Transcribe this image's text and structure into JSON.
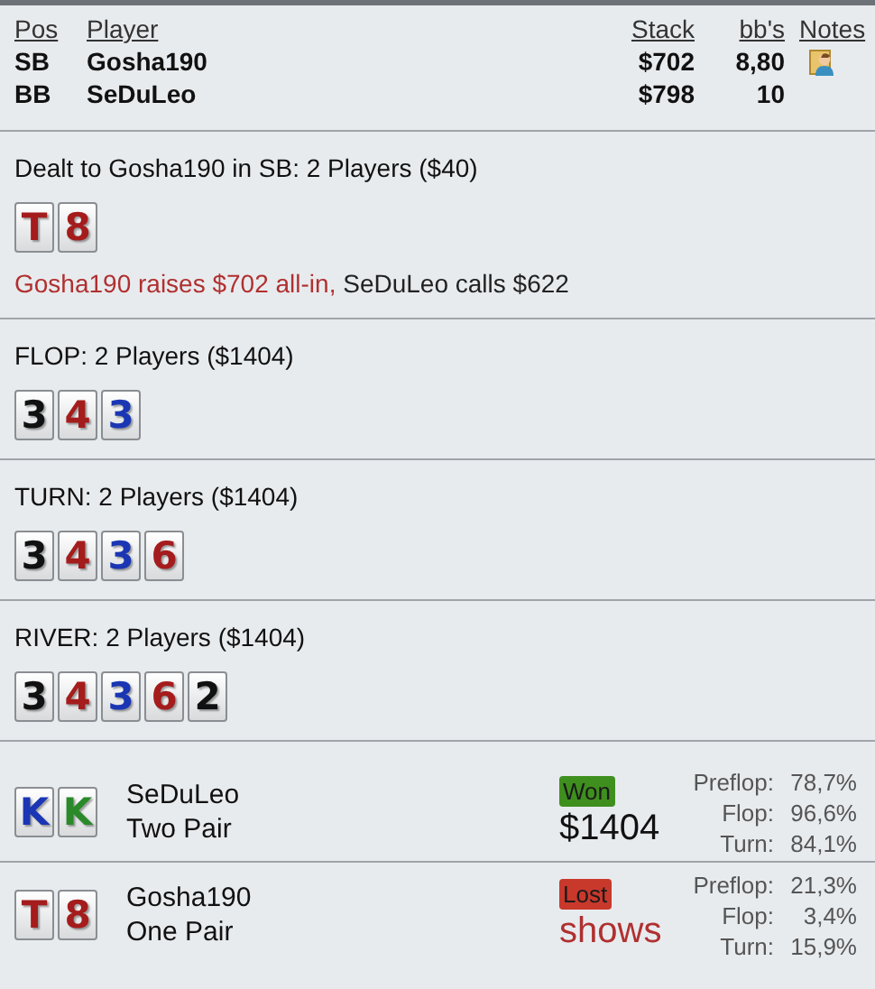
{
  "header": {
    "columns": [
      "Pos",
      "Player",
      "Stack",
      "bb's",
      "Notes"
    ]
  },
  "players": [
    {
      "pos": "SB",
      "name": "Gosha190",
      "stack": "$702",
      "bbs": "8,80",
      "note": true
    },
    {
      "pos": "BB",
      "name": "SeDuLeo",
      "stack": "$798",
      "bbs": "10",
      "note": false
    }
  ],
  "streets": [
    {
      "title": "Dealt to Gosha190 in SB: 2 Players ($40)",
      "cards": [
        {
          "rank": "T",
          "color": "#a51c1c"
        },
        {
          "rank": "8",
          "color": "#a51c1c"
        }
      ],
      "actions": [
        {
          "text": "Gosha190 raises $702 all-in,",
          "kind": "raise"
        },
        {
          "text": "SeDuLeo calls $622",
          "kind": "call"
        }
      ]
    },
    {
      "title": "FLOP: 2 Players ($1404)",
      "cards": [
        {
          "rank": "3",
          "color": "#111111"
        },
        {
          "rank": "4",
          "color": "#a51c1c"
        },
        {
          "rank": "3",
          "color": "#1a36b4"
        }
      ]
    },
    {
      "title": "TURN: 2 Players ($1404)",
      "cards": [
        {
          "rank": "3",
          "color": "#111111"
        },
        {
          "rank": "4",
          "color": "#a51c1c"
        },
        {
          "rank": "3",
          "color": "#1a36b4"
        },
        {
          "rank": "6",
          "color": "#a51c1c"
        }
      ]
    },
    {
      "title": "RIVER: 2 Players ($1404)",
      "cards": [
        {
          "rank": "3",
          "color": "#111111"
        },
        {
          "rank": "4",
          "color": "#a51c1c"
        },
        {
          "rank": "3",
          "color": "#1a36b4"
        },
        {
          "rank": "6",
          "color": "#a51c1c"
        },
        {
          "rank": "2",
          "color": "#111111"
        }
      ]
    }
  ],
  "results": [
    {
      "cards": [
        {
          "rank": "K",
          "color": "#1a36b4"
        },
        {
          "rank": "K",
          "color": "#2a8a2a"
        }
      ],
      "name": "SeDuLeo",
      "hand": "Two Pair",
      "won": true,
      "badge": "Won",
      "amount": "$1404",
      "equity": [
        {
          "label": "Preflop:",
          "value": "78,7%"
        },
        {
          "label": "Flop:",
          "value": "96,6%"
        },
        {
          "label": "Turn:",
          "value": "84,1%"
        }
      ]
    },
    {
      "cards": [
        {
          "rank": "T",
          "color": "#a51c1c"
        },
        {
          "rank": "8",
          "color": "#a51c1c"
        }
      ],
      "name": "Gosha190",
      "hand": "One Pair",
      "won": false,
      "badge": "Lost",
      "amount": "shows",
      "equity": [
        {
          "label": "Preflop:",
          "value": "21,3%"
        },
        {
          "label": "Flop:",
          "value": "3,4%"
        },
        {
          "label": "Turn:",
          "value": "15,9%"
        }
      ]
    }
  ]
}
